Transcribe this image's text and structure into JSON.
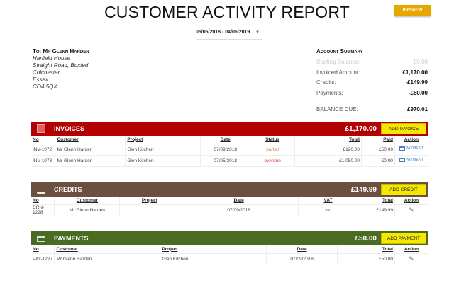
{
  "header": {
    "title": "CUSTOMER ACTIVITY REPORT",
    "preview_label": "PREVIEW",
    "date_range": "05/05/2018 - 04/05/2019"
  },
  "address": {
    "to": "To: Mr Glenn Harden",
    "lines": [
      "Harfield House",
      "Straight Road, Boxted",
      "Colchester",
      "Essex",
      "CO4 5QX"
    ]
  },
  "summary": {
    "title": "Account Summary",
    "starting_label": "Starting Balance:",
    "starting": "£0.00",
    "invoiced_label": "Invoiced Amount:",
    "invoiced": "£1,170.00",
    "credits_label": "Credits:",
    "credits": "-£149.99",
    "payments_label": "Payments:",
    "payments": "-£50.00",
    "due_label": "BALANCE DUE:",
    "due": "£970.01"
  },
  "invoices": {
    "title": "INVOICES",
    "amount": "£1,170.00",
    "button": "ADD INVOICE",
    "color": "#b30000",
    "columns": [
      "No",
      "Customer",
      "Project",
      "Date",
      "Status",
      "Total",
      "Paid",
      "Action"
    ],
    "rows": [
      {
        "no": "INV-1072",
        "customer": "Mr Glenn Harden",
        "project": "Glen Kitchen",
        "date": "07/09/2018",
        "status": "partial",
        "total": "£120.00",
        "paid": "£50.00",
        "action": "PAYMENT"
      },
      {
        "no": "INV-1073",
        "customer": "Mr Glenn Harden",
        "project": "Glen Kitchen",
        "date": "07/05/2018",
        "status": "overdue",
        "total": "£1,050.00",
        "paid": "£0.00",
        "action": "PAYMENT"
      }
    ]
  },
  "credits": {
    "title": "CREDITS",
    "amount": "£149.99",
    "button": "ADD CREDIT",
    "color": "#6b4f3f",
    "columns": [
      "No",
      "Customer",
      "Project",
      "Date",
      "VAT",
      "Total",
      "Action"
    ],
    "rows": [
      {
        "no": "CRN-1228",
        "customer": "Mr Glenn Harden",
        "project": "",
        "date": "07/09/2018",
        "vat": "No",
        "total": "£149.99"
      }
    ]
  },
  "payments": {
    "title": "PAYMENTS",
    "amount": "£50.00",
    "button": "ADD PAYMENT",
    "color": "#4a6b22",
    "columns": [
      "No",
      "Customer",
      "Project",
      "Date",
      "Total",
      "Action"
    ],
    "rows": [
      {
        "no": "PAY-1227",
        "customer": "Mr Glenn Harden",
        "project": "Glen Kitchen",
        "date": "07/09/2018",
        "total": "£50.00"
      }
    ]
  }
}
